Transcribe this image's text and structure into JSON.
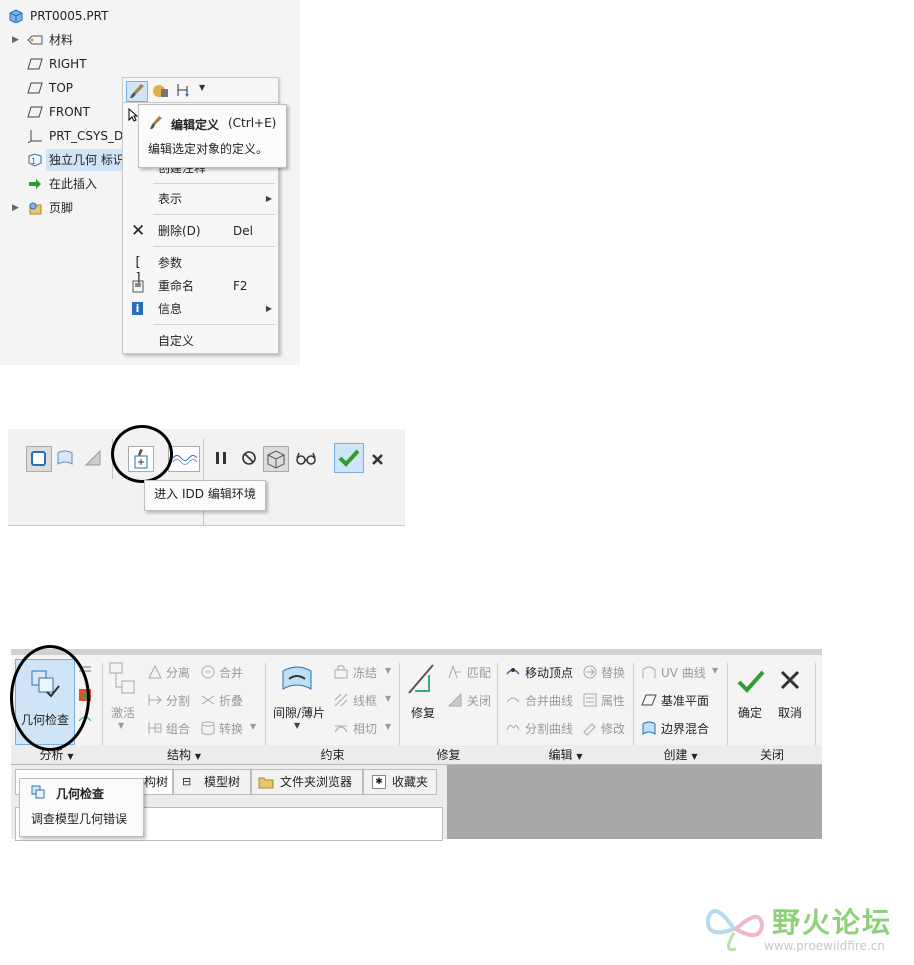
{
  "panel1": {
    "tree": [
      {
        "label": "PRT0005.PRT",
        "icon": "part-icon",
        "expander": ""
      },
      {
        "label": "材料",
        "icon": "material-icon",
        "expander": "▶"
      },
      {
        "label": "RIGHT",
        "icon": "datum-plane-icon",
        "expander": ""
      },
      {
        "label": "TOP",
        "icon": "datum-plane-icon",
        "expander": ""
      },
      {
        "label": "FRONT",
        "icon": "datum-plane-icon",
        "expander": ""
      },
      {
        "label": "PRT_CSYS_DEF",
        "icon": "csys-icon",
        "expander": ""
      },
      {
        "label": "独立几何 标识",
        "icon": "independent-geometry-icon",
        "expander": ""
      },
      {
        "label": "在此插入",
        "icon": "insert-here-arrow-icon",
        "expander": ""
      },
      {
        "label": "页脚",
        "icon": "footer-icon",
        "expander": "▶"
      }
    ],
    "context_menu": {
      "covered_item": "创建注释",
      "items": [
        {
          "label": "表示",
          "shortcut": "",
          "submenu": true,
          "icon": ""
        },
        {
          "label": "删除(D)",
          "shortcut": "Del",
          "submenu": false,
          "icon": "delete-x-icon"
        },
        {
          "label": "参数",
          "shortcut": "",
          "submenu": false,
          "icon": "parameters-icon"
        },
        {
          "label": "重命名",
          "shortcut": "F2",
          "submenu": false,
          "icon": "rename-icon"
        },
        {
          "label": "信息",
          "shortcut": "",
          "submenu": true,
          "icon": "info-icon"
        },
        {
          "label": "自定义",
          "shortcut": "",
          "submenu": false,
          "icon": ""
        }
      ]
    },
    "tooltip": {
      "title": "编辑定义",
      "shortcut": "(Ctrl+E)",
      "description": "编辑选定对象的定义。"
    }
  },
  "panel2": {
    "tooltip": "进入 IDD 编辑环境"
  },
  "panel3": {
    "groups": {
      "analysis": "分析",
      "structure": "结构",
      "constraint": "约束",
      "repair": "修复",
      "edit": "编辑",
      "create": "创建",
      "close": "关闭"
    },
    "buttons": {
      "geometry_check": "几何检查",
      "activate": "激活",
      "separate": "分离",
      "split": "分割",
      "combine": "组合",
      "merge": "合并",
      "fold": "折叠",
      "convert": "转换",
      "gap_sheet": "间隙/薄片",
      "freeze": "冻结",
      "wireframe": "线框",
      "tangent": "相切",
      "repair": "修复",
      "match": "匹配",
      "close_gap": "关闭",
      "move_vertex": "移动顶点",
      "merge_curve": "合并曲线",
      "split_curve": "分割曲线",
      "replace": "替换",
      "attribute": "属性",
      "modify": "修改",
      "uv_curve": "UV 曲线",
      "datum_plane": "基准平面",
      "boundary_blend": "边界混合",
      "ok": "确定",
      "cancel": "取消"
    },
    "tabs": {
      "tree_partial": "构树",
      "model_tree": "模型树",
      "folder_browser": "文件夹浏览器",
      "favorites": "收藏夹"
    },
    "tooltip": {
      "title": "几何检查",
      "description": "调查模型几何错误"
    }
  },
  "watermark": {
    "name": "野火论坛",
    "url": "www.proewildfire.cn"
  },
  "colors": {
    "selection": "#cfe4f6",
    "ok_green": "#2f9e2f",
    "accent_blue": "#2a6fb5",
    "watermark_green": "#8fd07a"
  }
}
